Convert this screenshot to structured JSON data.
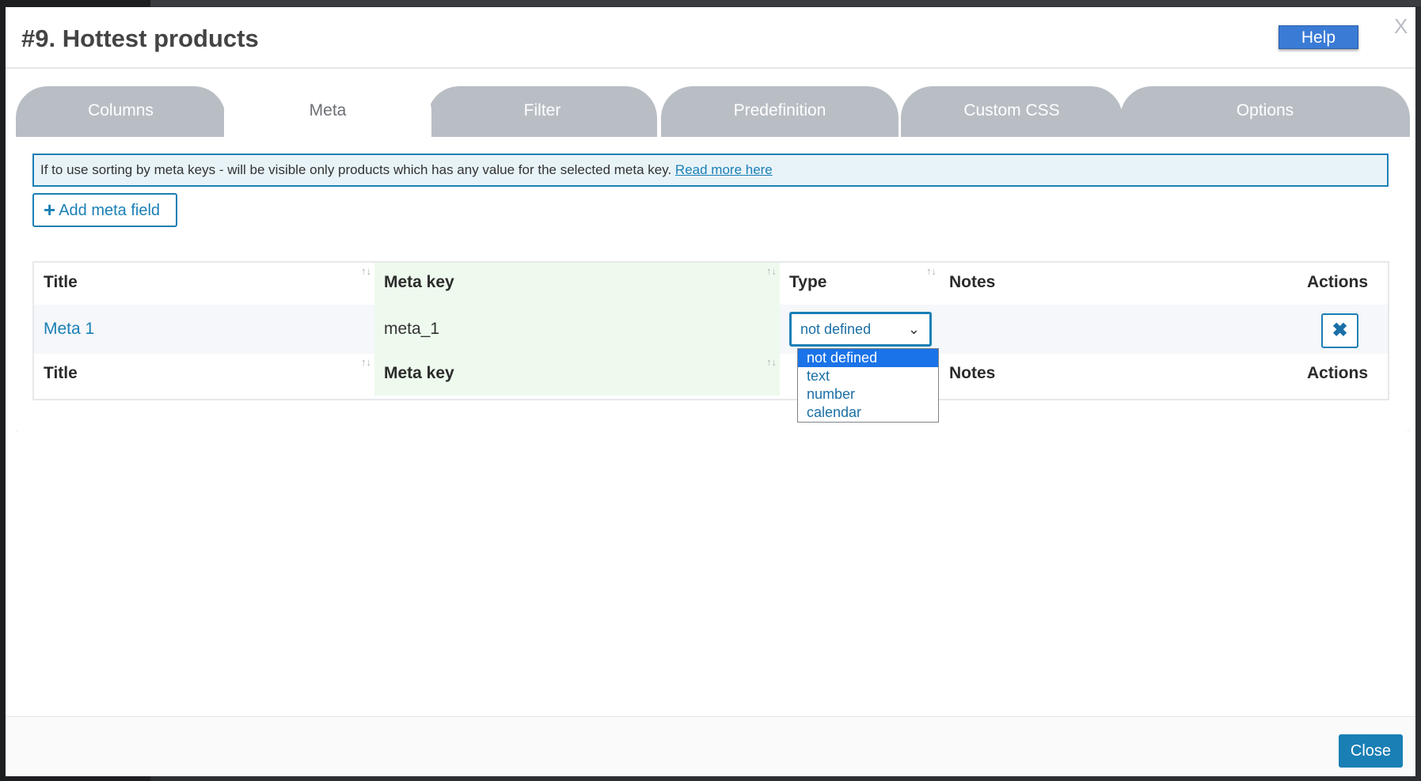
{
  "modal": {
    "title": "#9. Hottest products",
    "help_label": "Help",
    "close_x": "X"
  },
  "tabs": [
    {
      "label": "Columns"
    },
    {
      "label": "Meta",
      "active": true
    },
    {
      "label": "Filter"
    },
    {
      "label": "Predefinition"
    },
    {
      "label": "Custom CSS"
    },
    {
      "label": "Options"
    }
  ],
  "notice": {
    "text": "If to use sorting by meta keys - will be visible only products which has any value for the selected meta key.",
    "link": "Read more here"
  },
  "add_meta_label": "Add meta field",
  "table": {
    "headers": [
      "Title",
      "Meta key",
      "Type",
      "Notes",
      "Actions"
    ],
    "footer_headers": [
      "Title",
      "Meta key",
      "Notes",
      "Actions"
    ],
    "sort_icon": "↑↓",
    "rows": [
      {
        "title": "Meta 1",
        "meta_key": "meta_1",
        "type": "not defined",
        "notes": ""
      }
    ]
  },
  "type_dropdown": {
    "options": [
      "not defined",
      "text",
      "number",
      "calendar"
    ],
    "selected": "not defined"
  },
  "icons": {
    "add": "plus-icon",
    "delete": "close-icon",
    "chevron": "chevron-down-icon"
  },
  "colors": {
    "accent": "#1a7fb5",
    "help": "#3a7bd5",
    "tab_inactive": "#b9bec5",
    "meta_column": "#eefaee"
  },
  "footer": {
    "close_label": "Close"
  }
}
